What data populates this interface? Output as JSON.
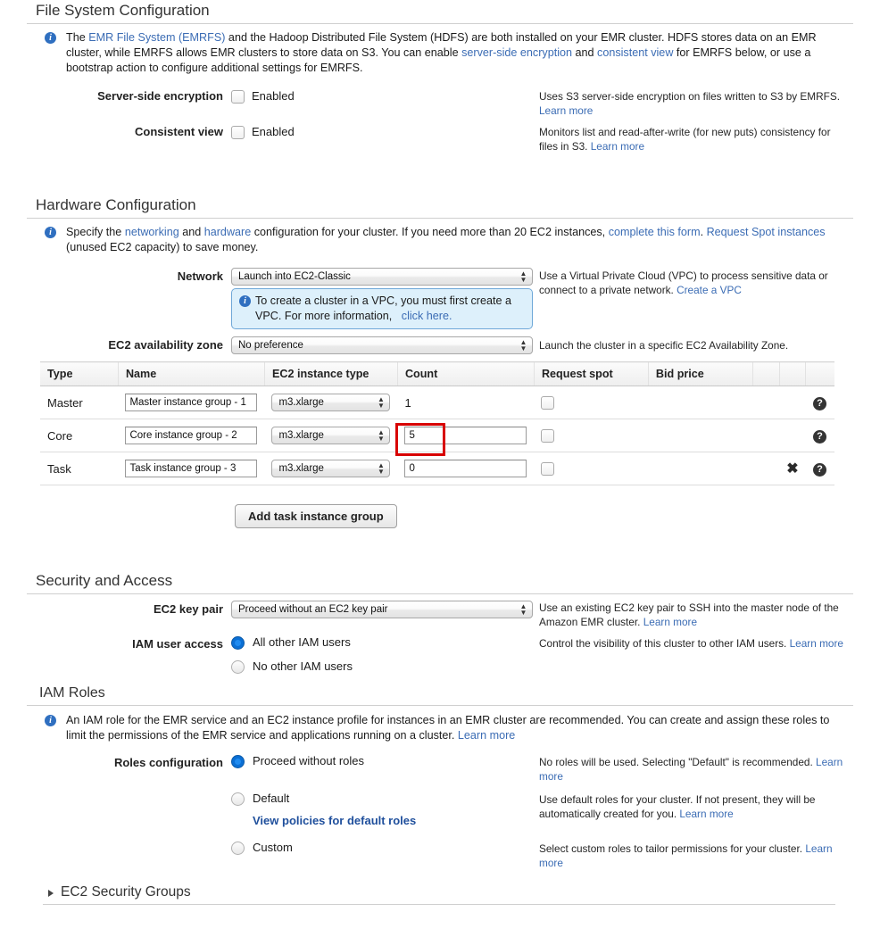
{
  "filesystem": {
    "heading": "File System Configuration",
    "info_pre": "The ",
    "info_link1": "EMR File System (EMRFS)",
    "info_mid1": " and the Hadoop Distributed File System (HDFS) are both installed on your EMR cluster. HDFS stores data on an EMR cluster, while EMRFS allows EMR clusters to store data on S3. You can enable ",
    "info_link2": "server-side encryption",
    "info_mid2": " and ",
    "info_link3": "consistent view",
    "info_end": " for EMRFS below, or use a bootstrap action to configure additional settings for EMRFS.",
    "sse_label": "Server-side encryption",
    "sse_checkbox_label": "Enabled",
    "sse_checked": false,
    "sse_help": "Uses S3 server-side encryption on files written to S3 by EMRFS.",
    "sse_help_link": "Learn more",
    "cv_label": "Consistent view",
    "cv_checkbox_label": "Enabled",
    "cv_checked": false,
    "cv_help": "Monitors list and read-after-write (for new puts) consistency for files in S3.",
    "cv_help_link": "Learn more"
  },
  "hardware": {
    "heading": "Hardware Configuration",
    "info_pre": "Specify the ",
    "info_link1": "networking",
    "info_mid1": " and ",
    "info_link2": "hardware",
    "info_mid2": " configuration for your cluster. If you need more than 20 EC2 instances, ",
    "info_link3": "complete this form",
    "info_mid3": ". ",
    "info_link4": "Request Spot instances",
    "info_end": " (unused EC2 capacity) to save money.",
    "network_label": "Network",
    "network_value": "Launch into EC2-Classic",
    "network_help": "Use a Virtual Private Cloud (VPC) to process sensitive data or connect to a private network.",
    "network_help_link": "Create a VPC",
    "vpc_callout_pre": "To create a cluster in a VPC, you must first create a VPC. For more information,",
    "vpc_callout_link": "click here.",
    "az_label": "EC2 availability zone",
    "az_value": "No preference",
    "az_help": "Launch the cluster in a specific EC2 Availability Zone.",
    "table": {
      "columns": [
        "Type",
        "Name",
        "EC2 instance type",
        "Count",
        "Request spot",
        "Bid price",
        "",
        "",
        ""
      ],
      "rows": [
        {
          "type": "Master",
          "name": "Master instance group - 1",
          "instance_type": "m3.xlarge",
          "count": "1",
          "count_is_input": false,
          "request_spot": false,
          "bid_price": "",
          "removable": false,
          "help_icon": "question-icon"
        },
        {
          "type": "Core",
          "name": "Core instance group - 2",
          "instance_type": "m3.xlarge",
          "count": "5",
          "count_is_input": true,
          "request_spot": false,
          "bid_price": "",
          "removable": false,
          "help_icon": "question-icon"
        },
        {
          "type": "Task",
          "name": "Task instance group - 3",
          "instance_type": "m3.xlarge",
          "count": "0",
          "count_is_input": true,
          "request_spot": false,
          "bid_price": "",
          "removable": true,
          "help_icon": "question-icon"
        }
      ]
    },
    "add_task_button": "Add task instance group"
  },
  "security": {
    "heading": "Security and Access",
    "keypair_label": "EC2 key pair",
    "keypair_value": "Proceed without an EC2 key pair",
    "keypair_help": "Use an existing EC2 key pair to SSH into the master node of the Amazon EMR cluster.",
    "keypair_help_link": "Learn more",
    "iam_label": "IAM user access",
    "iam_option1": "All other IAM users",
    "iam_option2": "No other IAM users",
    "iam_selected": "All other IAM users",
    "iam_help": "Control the visibility of this cluster to other IAM users.",
    "iam_help_link": "Learn more"
  },
  "iam_roles": {
    "heading": "IAM Roles",
    "info_text": "An IAM role for the EMR service and an EC2 instance profile for instances in an EMR cluster are recommended. You can create and assign these roles to limit the permissions of the EMR service and applications running on a cluster. ",
    "info_link": "Learn more",
    "roles_label": "Roles configuration",
    "option1": "Proceed without roles",
    "option1_help": "No roles will be used. Selecting \"Default\" is recommended.",
    "option1_help_link": "Learn more",
    "option2": "Default",
    "option2_sublink": "View policies for default roles",
    "option2_help": "Use default roles for your cluster. If not present, they will be automatically created for you.",
    "option2_help_link": "Learn more",
    "option3": "Custom",
    "option3_help": "Select custom roles to tailor permissions for your cluster.",
    "option3_help_link": "Learn more",
    "selected": "Proceed without roles"
  },
  "security_groups": {
    "heading": "EC2 Security Groups",
    "expanded": false
  },
  "colors": {
    "link": "#3b6cb4",
    "link_bold": "#1f4f9c",
    "info_icon": "#2f6fc0",
    "radio_selected": "#0b6fd4",
    "highlight": "#d80000",
    "callout_bg": "#ddf0fb"
  }
}
